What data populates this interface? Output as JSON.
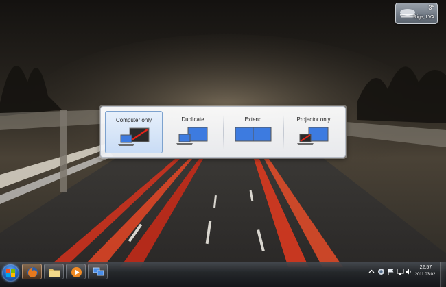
{
  "weather": {
    "temperature": "3°",
    "location": "Riga, LVA",
    "icon": "fog-icon"
  },
  "projector_dialog": {
    "options": [
      {
        "label": "Computer only",
        "icon": "computer-only-icon",
        "selected": true
      },
      {
        "label": "Duplicate",
        "icon": "duplicate-icon",
        "selected": false
      },
      {
        "label": "Extend",
        "icon": "extend-icon",
        "selected": false
      },
      {
        "label": "Projector only",
        "icon": "projector-only-icon",
        "selected": false
      }
    ]
  },
  "taskbar": {
    "start_icon": "windows-logo-icon",
    "pinned": [
      {
        "icon": "firefox-icon",
        "active": true
      },
      {
        "icon": "folder-icon",
        "active": false
      },
      {
        "icon": "media-player-icon",
        "active": false
      },
      {
        "icon": "display-icon",
        "active": false
      }
    ],
    "tray_icons": [
      "chevron-up-icon",
      "network-icon",
      "flag-icon",
      "monitor-icon",
      "speaker-icon"
    ],
    "clock": {
      "time": "22:57",
      "date": "2011.03.02."
    }
  },
  "colors": {
    "selection": "#c9dcf5",
    "screen_blue": "#3d7be0",
    "taskbar": "#24272b"
  }
}
